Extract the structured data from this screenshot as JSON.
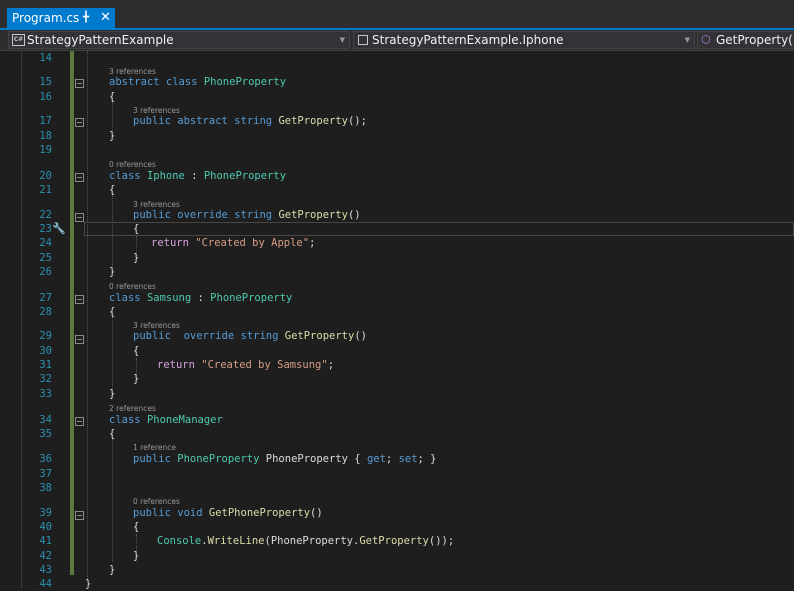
{
  "tab": {
    "title": "Program.cs",
    "pin_icon": "pin-icon",
    "close_icon": "close-icon"
  },
  "nav": {
    "project": "StrategyPatternExample",
    "type": "StrategyPatternExample.Iphone",
    "member": "GetProperty()"
  },
  "lens": {
    "r3": "3 references",
    "r0": "0 references",
    "r2": "2 references",
    "r1": "1 reference"
  },
  "line_numbers": [
    "14",
    "15",
    "16",
    "17",
    "18",
    "19",
    "20",
    "21",
    "22",
    "23",
    "24",
    "25",
    "26",
    "27",
    "28",
    "29",
    "30",
    "31",
    "32",
    "33",
    "34",
    "35",
    "36",
    "37",
    "38",
    "39",
    "40",
    "41",
    "42",
    "43",
    "44"
  ],
  "code": {
    "abstract": "abstract",
    "class": "class",
    "public": "public",
    "override": "override",
    "string": "string",
    "return": "return",
    "void": "void",
    "get": "get",
    "set": "set",
    "PhoneProperty": "PhoneProperty",
    "Iphone": "Iphone",
    "Samsung": "Samsung",
    "PhoneManager": "PhoneManager",
    "Console": "Console",
    "GetProperty": "GetProperty",
    "GetPhoneProperty": "GetPhoneProperty",
    "WriteLine": "WriteLine",
    "apple_str": "\"Created by Apple\"",
    "samsung_str": "\"Created by Samsung\""
  }
}
